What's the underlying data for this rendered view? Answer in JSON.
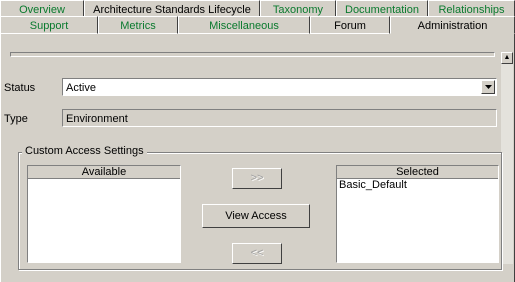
{
  "tabs_back": [
    {
      "label": "Overview",
      "style": "green"
    },
    {
      "label": "Architecture Standards Lifecycle",
      "style": "normal"
    },
    {
      "label": "Taxonomy",
      "style": "green"
    },
    {
      "label": "Documentation",
      "style": "green"
    },
    {
      "label": "Relationships",
      "style": "green"
    }
  ],
  "tabs_front": [
    {
      "label": "Support",
      "style": "green"
    },
    {
      "label": "Metrics",
      "style": "green"
    },
    {
      "label": "Miscellaneous",
      "style": "green"
    },
    {
      "label": "Forum",
      "style": "normal"
    },
    {
      "label": "Administration",
      "style": "active"
    }
  ],
  "form": {
    "status_label": "Status",
    "status_value": "Active",
    "type_label": "Type",
    "type_value": "Environment"
  },
  "access": {
    "group_title": "Custom Access Settings",
    "available_header": "Available",
    "selected_header": "Selected",
    "selected_items": [
      "Basic_Default"
    ],
    "add_button": ">>",
    "view_access_button": "View Access",
    "remove_button": "<<"
  },
  "colors": {
    "background": "#d4d0c8",
    "tab_green": "#0a7a2e"
  }
}
